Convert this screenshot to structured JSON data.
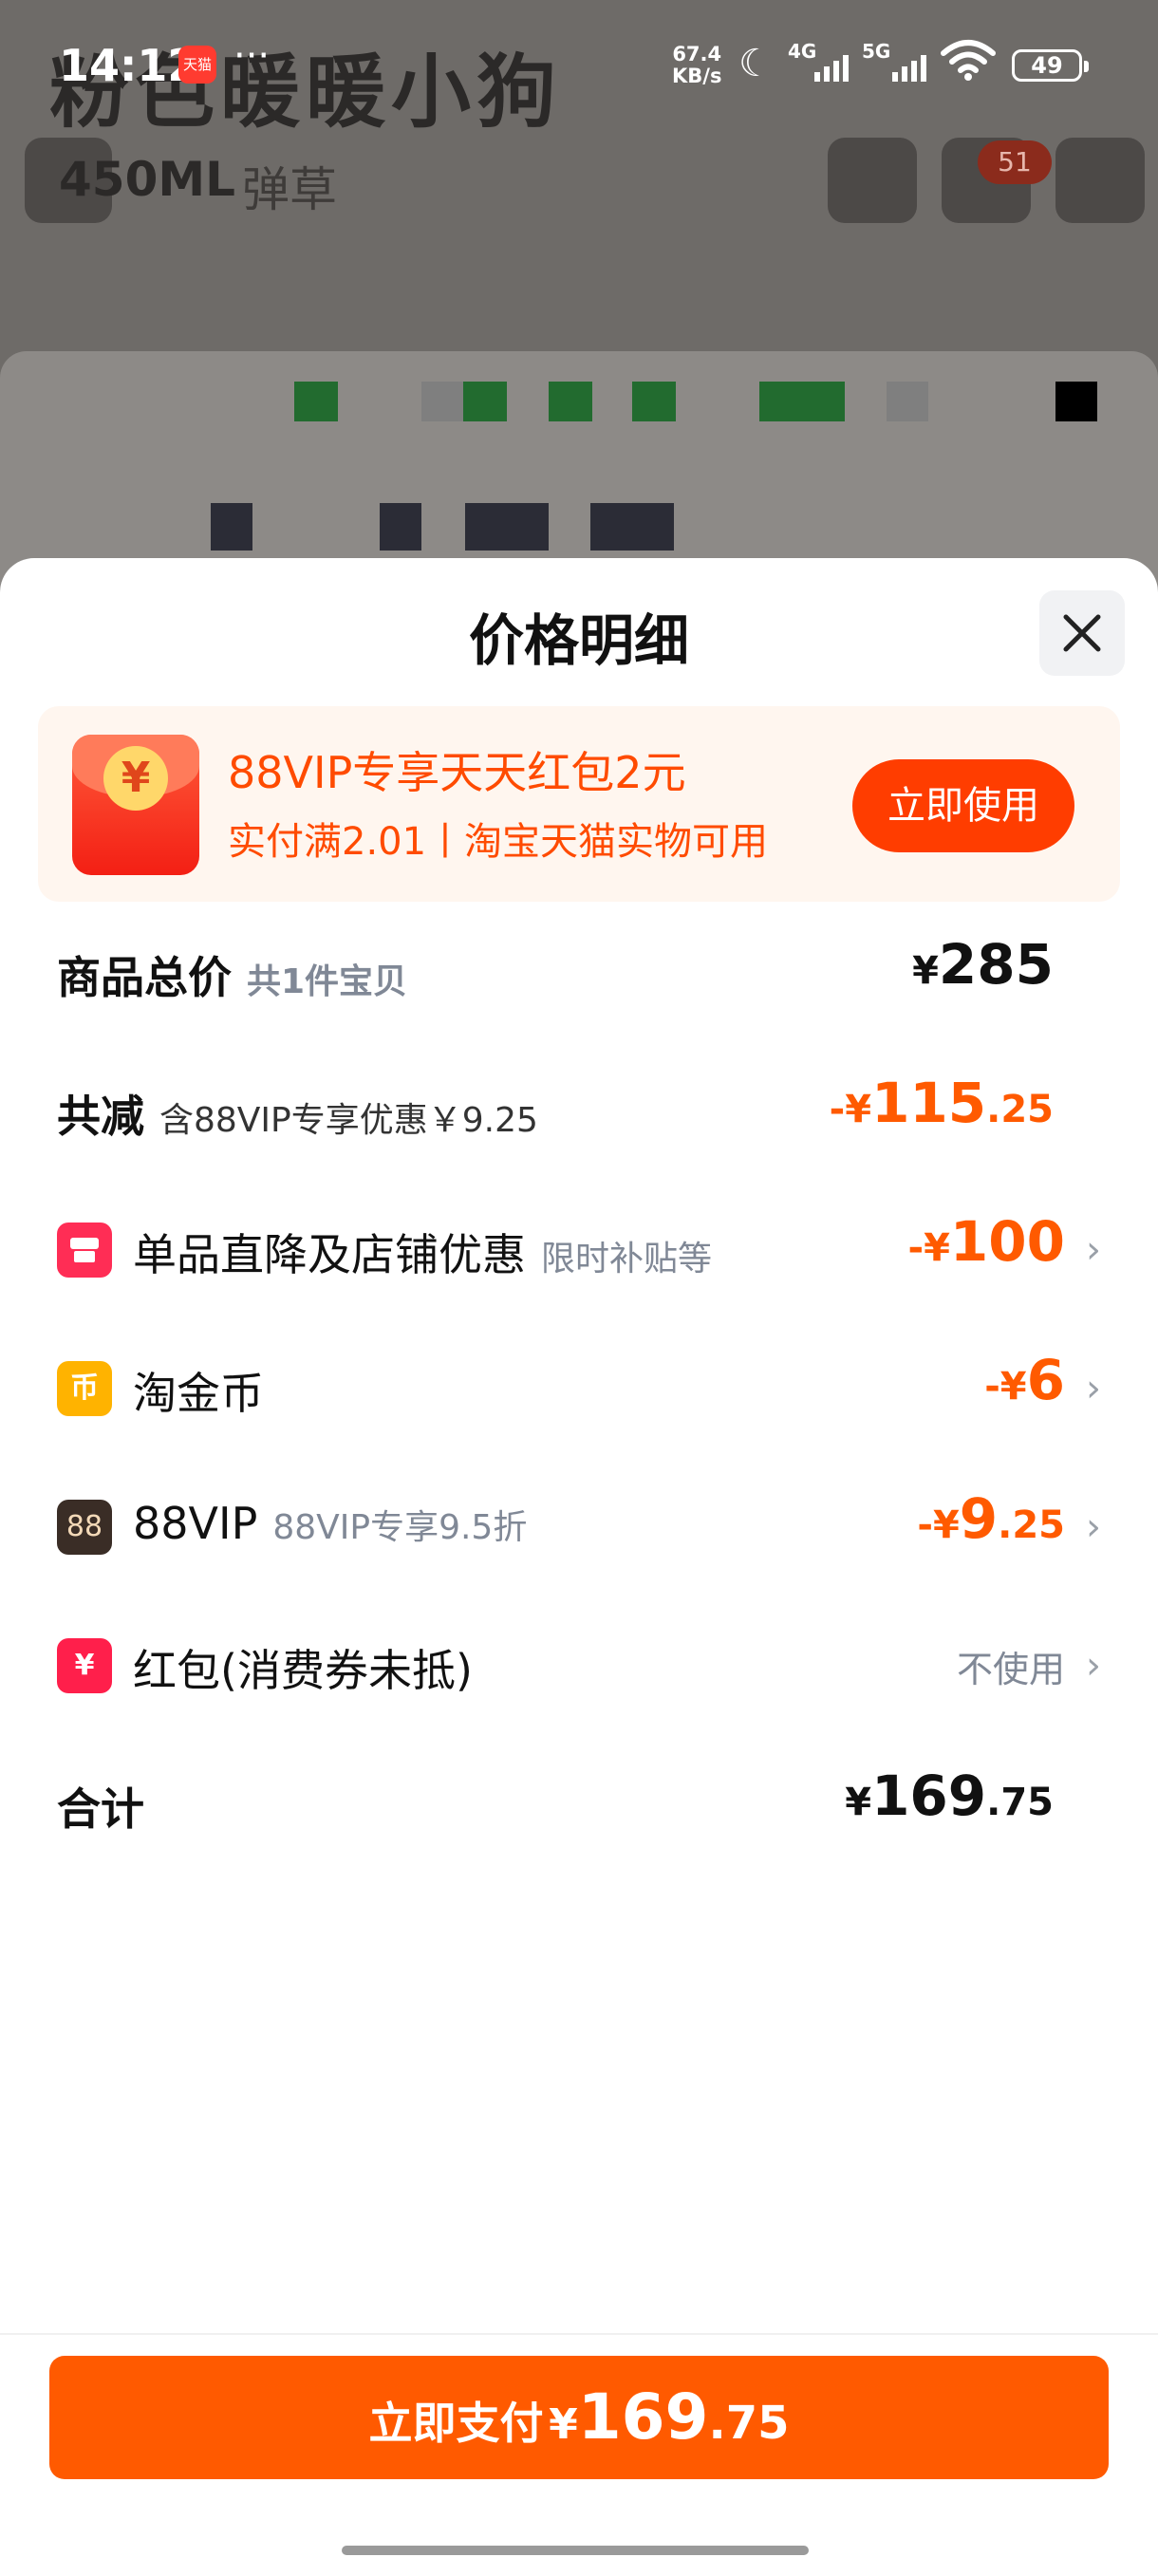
{
  "background": {
    "product_title": "粉色暖暖小狗",
    "volume": "450ML",
    "volume_suffix": "弹草",
    "cart_badge": "51"
  },
  "status_bar": {
    "time": "14:12",
    "app_badge": "天猫",
    "dots": "···",
    "speed_value": "67.4",
    "speed_unit": "KB/s",
    "sig1": "4G",
    "sig2": "5G",
    "battery": "49"
  },
  "sheet": {
    "title": "价格明细",
    "close_icon": "close-icon"
  },
  "promo": {
    "title": "88VIP专享天天红包2元",
    "subtitle": "实付满2.01丨淘宝天猫实物可用",
    "button": "立即使用",
    "coin": "¥"
  },
  "rows": {
    "total": {
      "label": "商品总价",
      "sub": "共1件宝贝",
      "sym": "¥",
      "int": "285",
      "dec": ""
    },
    "reduce": {
      "label": "共减",
      "sub": "含88VIP专享优惠￥9.25",
      "sym": "-¥",
      "int": "115",
      "dec": ".25"
    },
    "discount": {
      "label": "单品直降及店铺优惠",
      "sub": "限时补贴等",
      "sym": "-¥",
      "int": "100",
      "dec": "",
      "icon_color": "#ff2d55"
    },
    "coins": {
      "label": "淘金币",
      "sym": "-¥",
      "int": "6",
      "dec": "",
      "icon_text": "币",
      "icon_color": "#ffb300"
    },
    "vip": {
      "label": "88VIP",
      "sub": "88VIP专享9.5折",
      "sym": "-¥",
      "int": "9",
      "dec": ".25",
      "icon_text": "88",
      "icon_color": "#3a2d26"
    },
    "redpacket": {
      "label": "红包(消费券未抵)",
      "value": "不使用",
      "icon_text": "¥",
      "icon_color": "#ff1f4b"
    },
    "sum": {
      "label": "合计",
      "sym": "¥",
      "int": "169",
      "dec": ".75"
    }
  },
  "pay": {
    "label": "立即支付",
    "sym": "¥",
    "int": "169",
    "dec": ".75"
  },
  "colors": {
    "accent": "#ff5a00",
    "promo_button": "#ff3d00"
  }
}
